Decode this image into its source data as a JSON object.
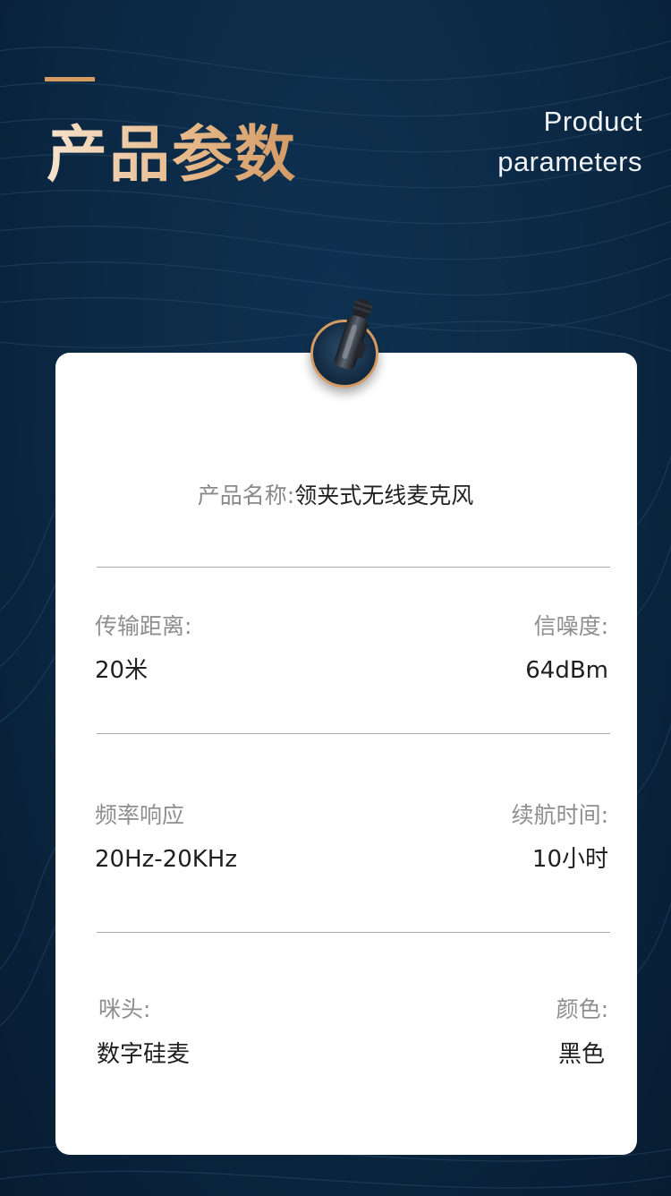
{
  "header": {
    "title_cn": "产品参数",
    "title_en_line1": "Product",
    "title_en_line2": "parameters"
  },
  "product": {
    "name_label": "产品名称:",
    "name_value": "领夹式无线麦克风",
    "icon": "lavalier-microphone-icon"
  },
  "specs": [
    {
      "left_label": "传输距离:",
      "left_value": "20米",
      "right_label": "信噪度:",
      "right_value": "64dBm"
    },
    {
      "left_label": "频率响应",
      "left_value": "20Hz-20KHz",
      "right_label": "续航时间:",
      "right_value": "10小时"
    },
    {
      "left_label": "咪头:",
      "left_value": "数字硅麦",
      "right_label": "颜色:",
      "right_value": "黑色"
    }
  ],
  "colors": {
    "background": "#0b2843",
    "accent": "#d59b62",
    "card": "#ffffff"
  }
}
